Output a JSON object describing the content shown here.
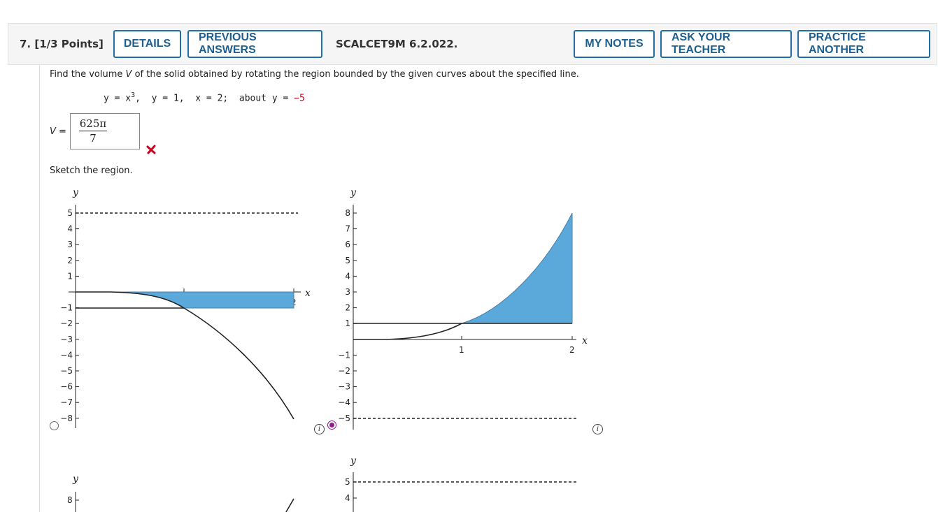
{
  "header": {
    "question_number": "7.",
    "points": "[1/3 Points]",
    "details_label": "DETAILS",
    "previous_answers_label": "PREVIOUS ANSWERS",
    "source_label": "SCALCET9M 6.2.022.",
    "my_notes_label": "MY NOTES",
    "ask_teacher_label": "ASK YOUR TEACHER",
    "practice_another_label": "PRACTICE ANOTHER"
  },
  "problem": {
    "prompt_part1": "Find the volume ",
    "prompt_var": "V",
    "prompt_part2": " of the solid obtained by rotating the region bounded by the given curves about the specified line.",
    "eq_part1": "y = x",
    "eq_exp": "3",
    "eq_part2": ",  y = 1,  x = 2;  about y = ",
    "eq_value": "−5",
    "answer_label": "V =",
    "answer_numerator": "625π",
    "answer_denominator": "7",
    "answer_status_icon": "x-mark-icon",
    "sketch_prompt": "Sketch the region."
  },
  "graph_labels": {
    "x_axis": "x",
    "y_axis": "y",
    "info_glyph": "i"
  },
  "graph_a": {
    "selected": false,
    "y_ticks": [
      "5",
      "4",
      "3",
      "2",
      "1",
      "−1",
      "−2",
      "−3",
      "−4",
      "−5",
      "−6",
      "−7",
      "−8"
    ],
    "x_ticks": [
      "1",
      "2"
    ]
  },
  "graph_b": {
    "selected": true,
    "y_ticks": [
      "8",
      "7",
      "6",
      "5",
      "4",
      "3",
      "2",
      "1",
      "−1",
      "−2",
      "−3",
      "−4",
      "−5"
    ],
    "x_ticks": [
      "1",
      "2"
    ]
  },
  "graph_c": {
    "y_ticks": [
      "8"
    ]
  },
  "graph_d": {
    "y_ticks": [
      "5",
      "4"
    ]
  },
  "colors": {
    "region_fill": "#5ba8db",
    "accent": "#1d6fa5",
    "radio_selected": "#8a1c8e",
    "error": "#d0021b"
  }
}
